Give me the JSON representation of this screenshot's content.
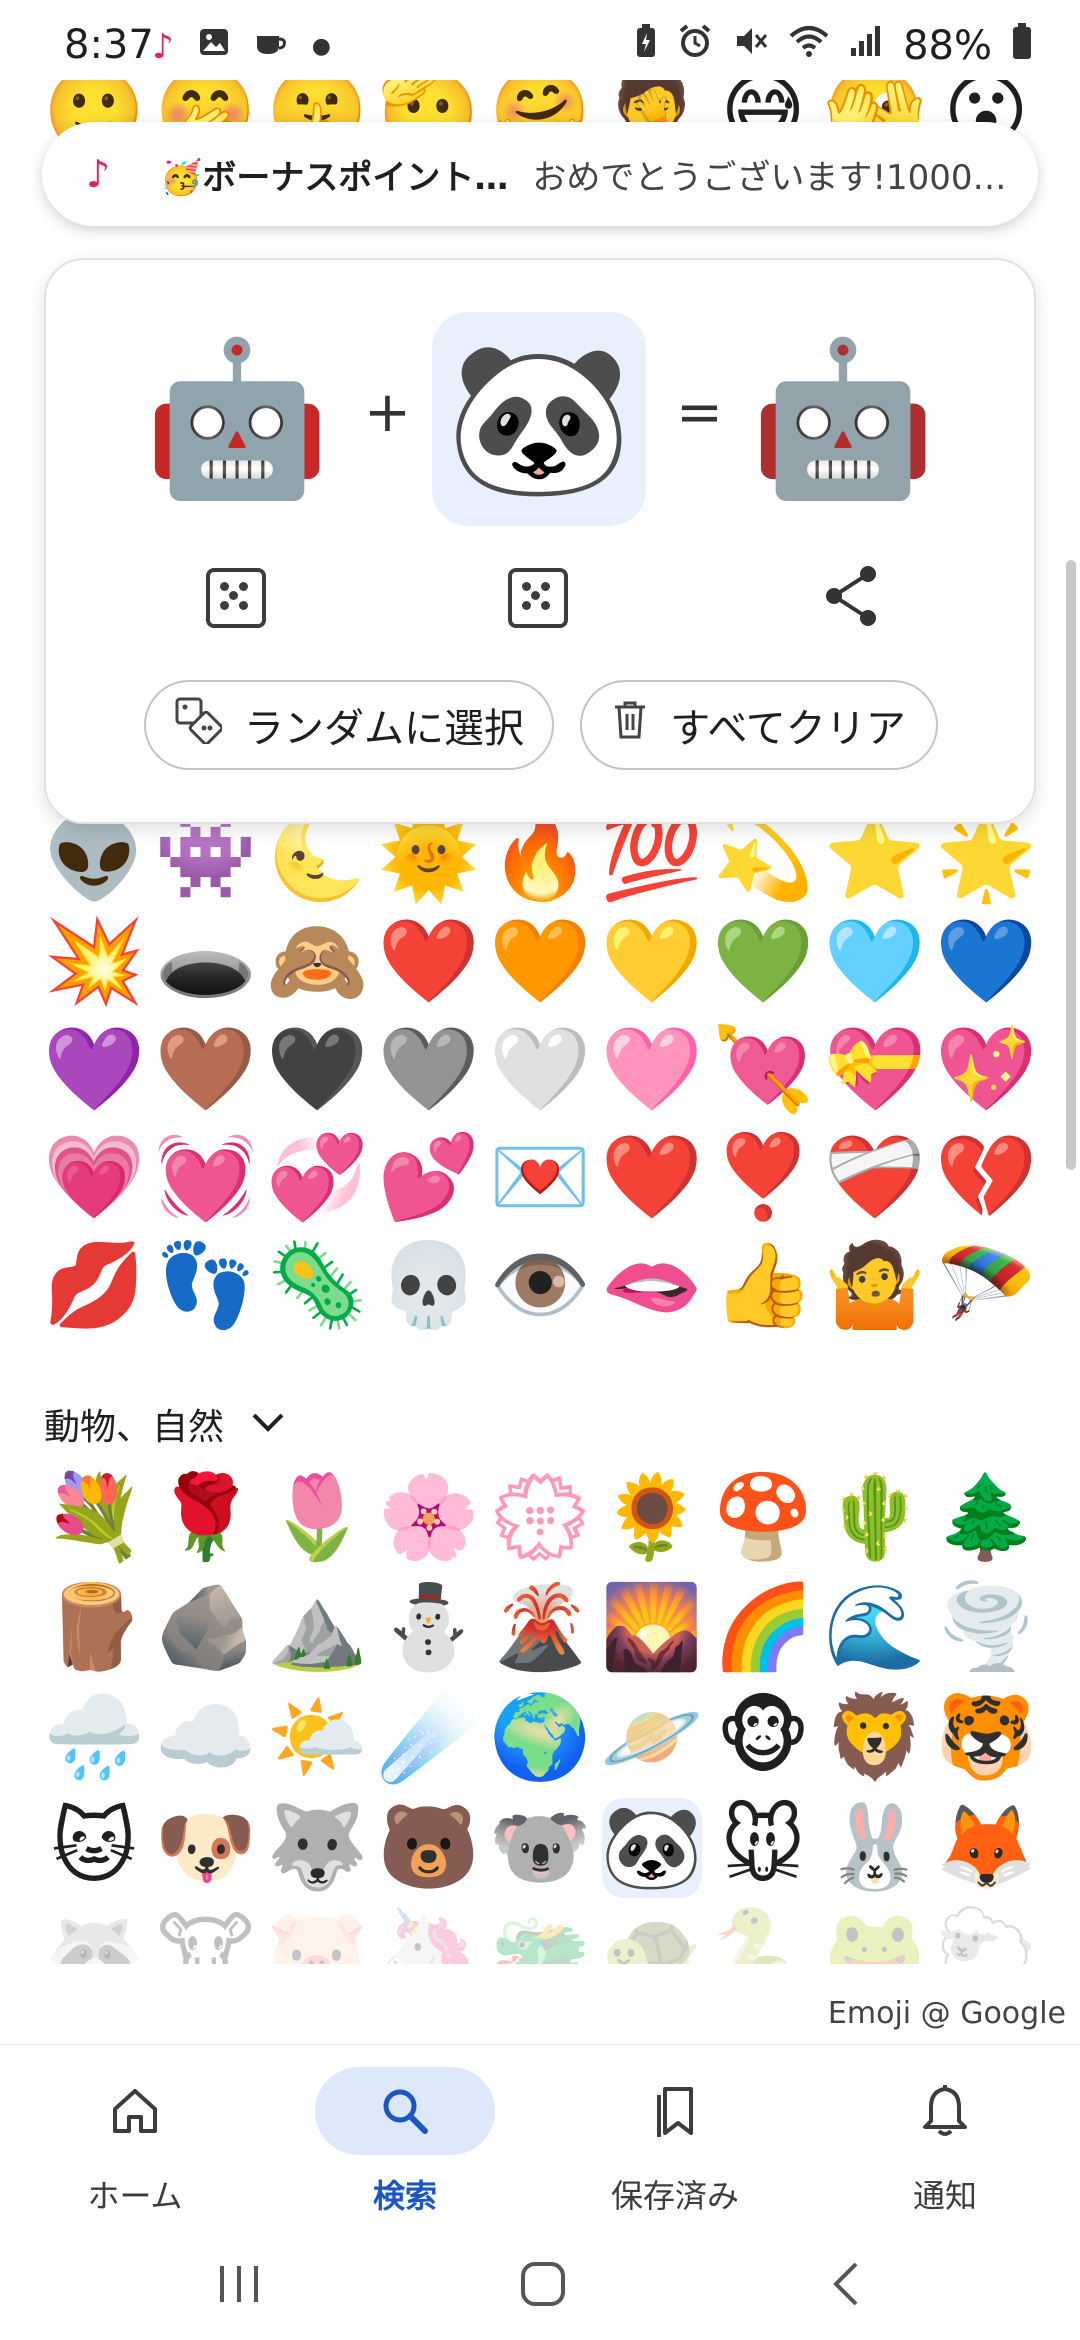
{
  "status_bar": {
    "time": "8:37",
    "left_icons": [
      "tiktok-icon",
      "image-icon",
      "cup-icon",
      "dot-icon"
    ],
    "battery": "88%"
  },
  "background_emojis_top": [
    "🙂",
    "🤭",
    "🤫",
    "🫡",
    "🤗",
    "🤦",
    "😅",
    "🫣",
    "😮"
  ],
  "notification": {
    "app_icon": "♪",
    "title": "🥳ボーナスポイント…",
    "text": "おめでとうございます!1000…"
  },
  "kitchen": {
    "left_emoji": "🤖",
    "right_emoji": "🐼",
    "result_emoji": "🤖",
    "plus": "+",
    "equals": "=",
    "random_button": "ランダムに選択",
    "clear_button": "すべてクリア"
  },
  "emoji_grid_1": [
    [
      "👽",
      "👾",
      "🌜",
      "🌞",
      "🔥",
      "💯",
      "💫",
      "⭐",
      "🌟"
    ],
    [
      "💥",
      "🕳️",
      "🙈",
      "❤️",
      "🧡",
      "💛",
      "💚",
      "🩵",
      "💙"
    ],
    [
      "💜",
      "🤎",
      "🖤",
      "🩶",
      "🤍",
      "🩷",
      "💘",
      "💝",
      "💖"
    ],
    [
      "💗",
      "💓",
      "💞",
      "💕",
      "💌",
      "❤️",
      "❣️",
      "❤️‍🩹",
      "💔"
    ],
    [
      "💋",
      "👣",
      "🦠",
      "💀",
      "👁️",
      "🫦",
      "👍",
      "🤷",
      "🪂"
    ]
  ],
  "section": {
    "title": "動物、自然"
  },
  "emoji_grid_2": [
    [
      "💐",
      "🌹",
      "🌷",
      "🌸",
      "💮",
      "🌻",
      "🍄",
      "🌵",
      "🌲"
    ],
    [
      "🪵",
      "🪨",
      "⛰️",
      "⛄",
      "🌋",
      "🌄",
      "🌈",
      "🌊",
      "🌪️"
    ],
    [
      "🌧️",
      "☁️",
      "🌤️",
      "☄️",
      "🌍",
      "🪐",
      "🐵",
      "🦁",
      "🐯"
    ],
    [
      "🐱",
      "🐶",
      "🐺",
      "🐻",
      "🐨",
      "🐼",
      "🐭",
      "🐰",
      "🦊"
    ],
    [
      "🦝",
      "🐮",
      "🐷",
      "🦄",
      "🐲",
      "🐢",
      "🐍",
      "🐸",
      "🐑"
    ]
  ],
  "attribution": "Emoji @ Google",
  "bottom_nav": {
    "home": "ホーム",
    "search": "検索",
    "saved": "保存済み",
    "notifications": "通知"
  }
}
